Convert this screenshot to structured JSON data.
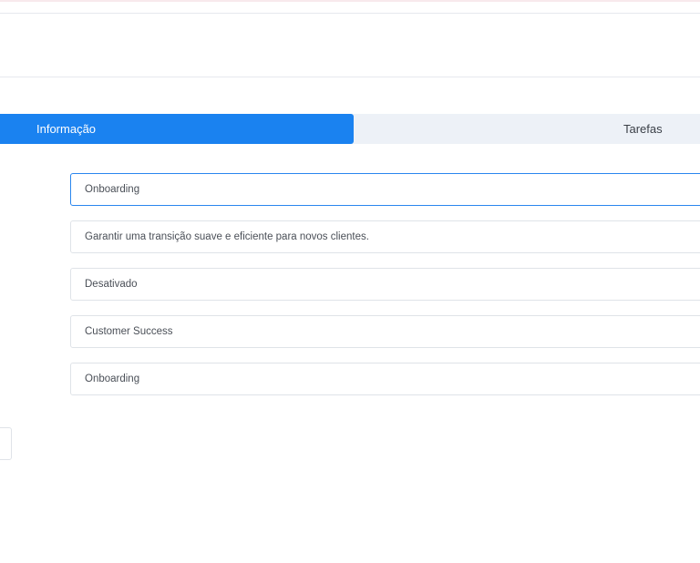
{
  "tabs": [
    {
      "label": "Informação",
      "active": true
    },
    {
      "label": "Tarefas",
      "active": false
    }
  ],
  "form": {
    "fields": [
      {
        "value": "Onboarding"
      },
      {
        "value": "Garantir uma transição suave e eficiente para novos clientes."
      },
      {
        "value": "Desativado"
      },
      {
        "value": "Customer Success"
      },
      {
        "value": "Onboarding"
      }
    ]
  },
  "colors": {
    "accent": "#1a82f0",
    "tab_bar_bg": "#edf1f7",
    "field_border": "#dfe3e8",
    "focus_border": "#2a86ee"
  }
}
